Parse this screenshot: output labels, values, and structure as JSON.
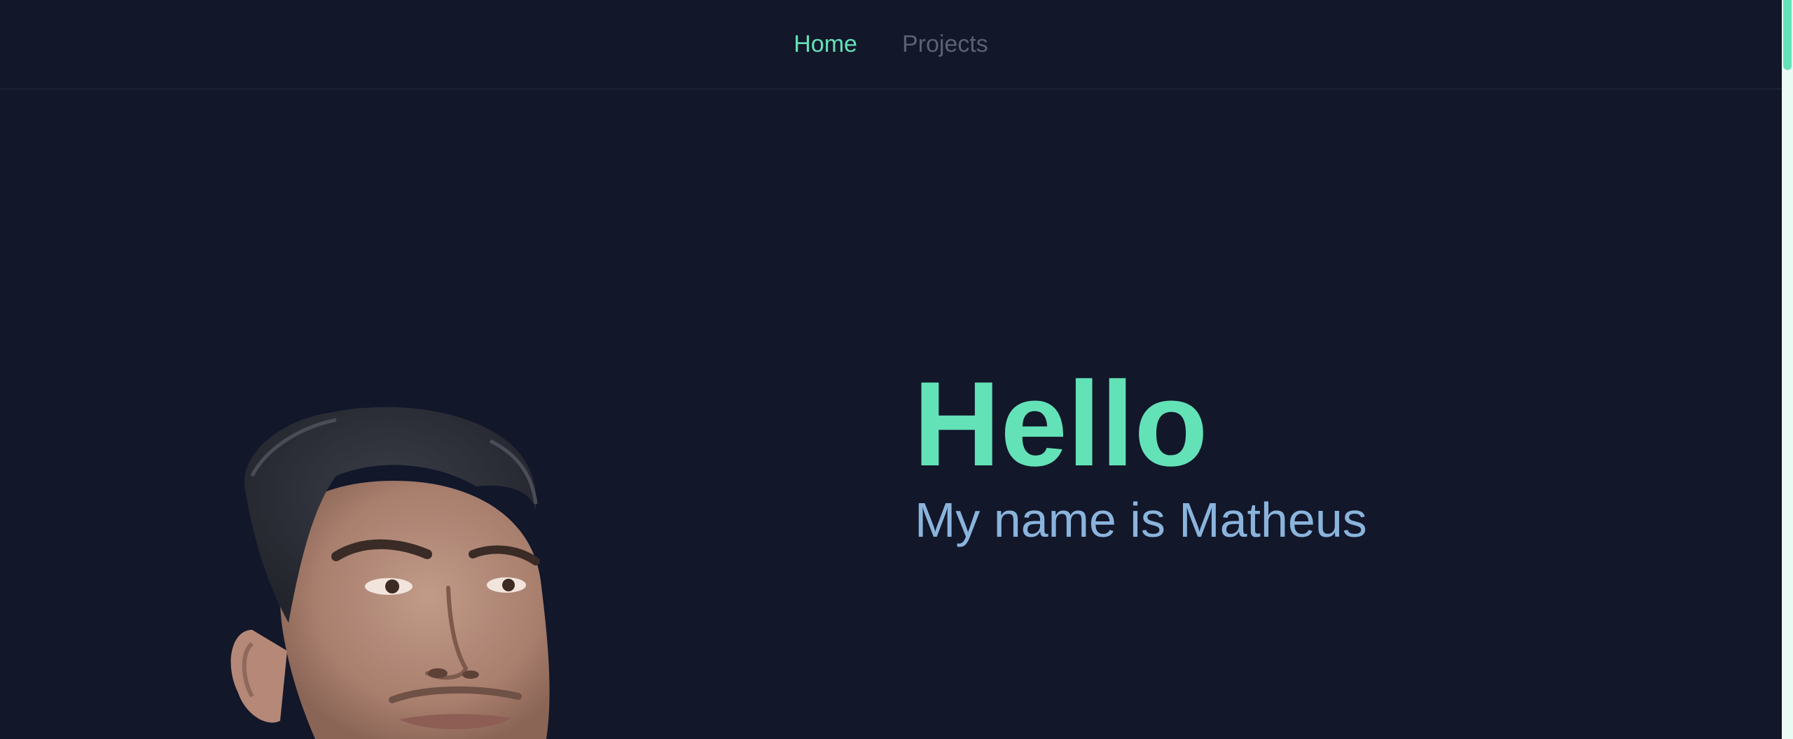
{
  "nav": {
    "items": [
      {
        "label": "Home",
        "active": true
      },
      {
        "label": "Projects",
        "active": false
      }
    ]
  },
  "hero": {
    "title": "Hello",
    "subtitle": "My name is Matheus"
  },
  "colors": {
    "background": "#12172a",
    "accent": "#64e2b7",
    "subtitle": "#8ab4dc",
    "nav_inactive": "#5a6173"
  },
  "portrait": {
    "icon": "portrait-photo"
  }
}
